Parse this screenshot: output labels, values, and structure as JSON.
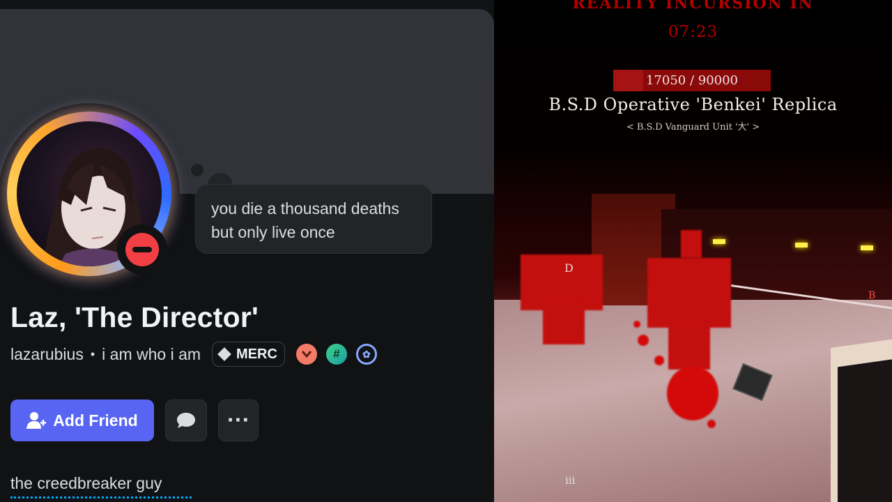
{
  "profile": {
    "display_name": "Laz, 'The Director'",
    "username": "lazarubius",
    "separator": "•",
    "pronouns": "i am who i am",
    "clan_tag": "MERC",
    "custom_status_line1": "you die a thousand deaths",
    "custom_status_line2": "but only live once",
    "status": "do-not-disturb",
    "badges": [
      "hypesquad-icon",
      "hash-icon",
      "laurel-icon"
    ],
    "bio": "the creedbreaker guy"
  },
  "actions": {
    "add_friend_label": "Add Friend",
    "more_label": "···"
  },
  "colors": {
    "primary_button": "#5865f2",
    "dnd_red": "#f23f43",
    "card_bg": "#111214",
    "banner_bg": "#313338"
  },
  "game": {
    "incursion_label": "REALITY INCURSION IN",
    "timer": "07:23",
    "boss_hp_current": 17050,
    "boss_hp_max": 90000,
    "boss_hp_text": "17050 / 90000",
    "boss_name": "B.S.D Operative 'Benkei' Replica",
    "boss_subtitle": "< B.S.D Vanguard Unit '大' >",
    "marker_d": "D",
    "marker_b": "B",
    "marker_iii": "iii"
  }
}
